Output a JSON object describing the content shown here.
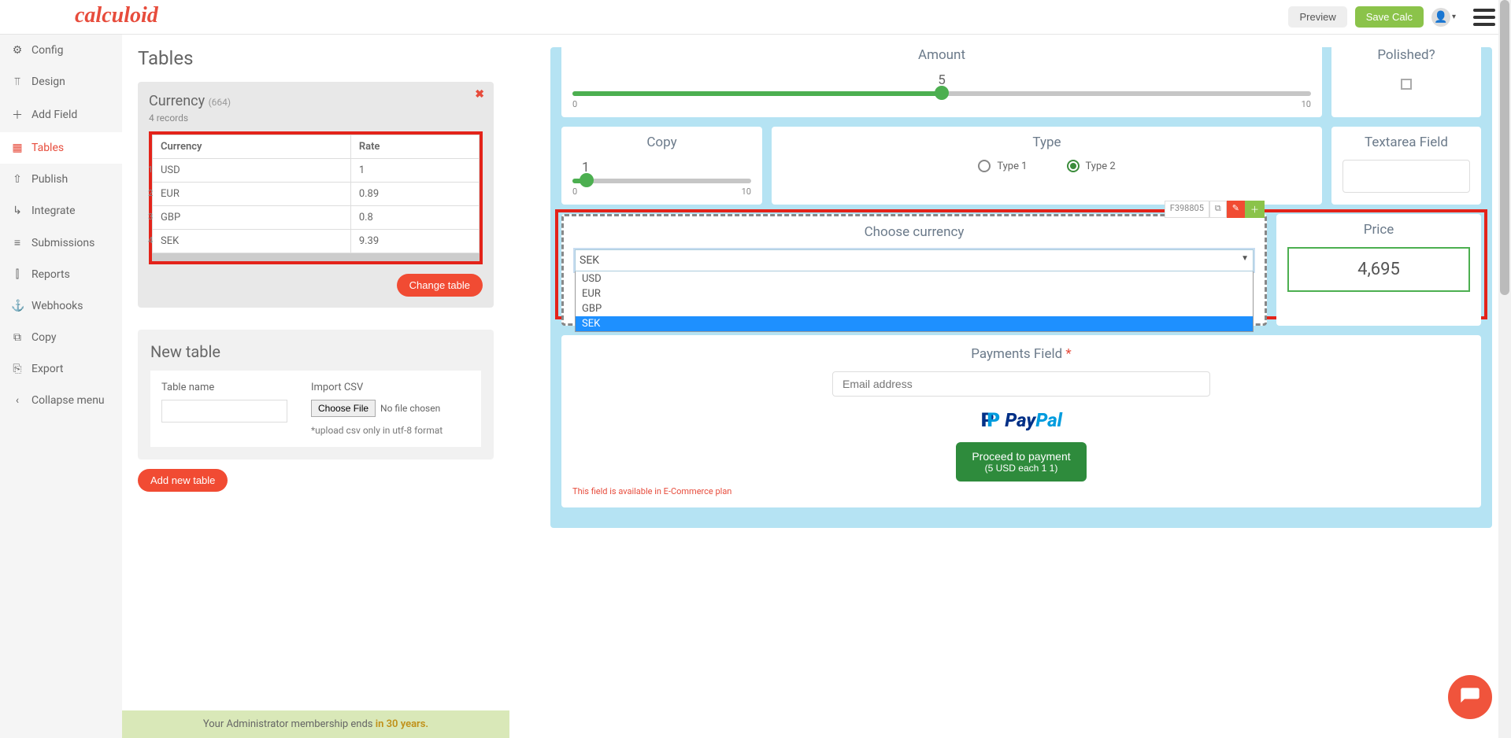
{
  "topnav": {
    "logo": "calculoid",
    "preview": "Preview",
    "save": "Save Calc"
  },
  "sidebar": {
    "items": [
      {
        "icon": "⚙",
        "label": "Config"
      },
      {
        "icon": "⊤",
        "label": "Design"
      },
      {
        "icon": "＋",
        "label": "Add Field"
      },
      {
        "icon": "▦",
        "label": "Tables"
      },
      {
        "icon": "⇧",
        "label": "Publish"
      },
      {
        "icon": "↳",
        "label": "Integrate"
      },
      {
        "icon": "≡",
        "label": "Submissions"
      },
      {
        "icon": "⫿",
        "label": "Reports"
      },
      {
        "icon": "⚓",
        "label": "Webhooks"
      },
      {
        "icon": "⧉",
        "label": "Copy"
      },
      {
        "icon": "⎘",
        "label": "Export"
      },
      {
        "icon": "‹",
        "label": "Collapse menu"
      }
    ]
  },
  "tables_panel": {
    "heading": "Tables",
    "currency": {
      "title": "Currency",
      "id": "(664)",
      "records": "4 records",
      "headers": [
        "Currency",
        "Rate"
      ],
      "rows": [
        {
          "n": "1",
          "c": "USD",
          "r": "1"
        },
        {
          "n": "2",
          "c": "EUR",
          "r": "0.89"
        },
        {
          "n": "3",
          "c": "GBP",
          "r": "0.8"
        },
        {
          "n": "4",
          "c": "SEK",
          "r": "9.39"
        }
      ],
      "change_btn": "Change table"
    },
    "new_table": {
      "title": "New table",
      "name_label": "Table name",
      "csv_label": "Import CSV",
      "choose_file": "Choose File",
      "no_file": "No file chosen",
      "hint": "*upload csv only in utf-8 format",
      "add_btn": "Add new table"
    }
  },
  "admin_bar": {
    "prefix": "Your Administrator membership ends ",
    "suffix": "in 30 years."
  },
  "calc": {
    "amount": {
      "title": "Amount",
      "value": "5",
      "min": "0",
      "max": "10"
    },
    "polished": {
      "title": "Polished?"
    },
    "copy": {
      "title": "Copy",
      "value": "1",
      "min": "0",
      "max": "10"
    },
    "type": {
      "title": "Type",
      "opt1": "Type 1",
      "opt2": "Type 2"
    },
    "textarea": {
      "title": "Textarea Field"
    },
    "currency_field": {
      "title": "Choose currency",
      "id": "F398805",
      "selected": "SEK",
      "options": [
        "USD",
        "EUR",
        "GBP",
        "SEK"
      ]
    },
    "price": {
      "title": "Price",
      "value": "4,695"
    },
    "payments": {
      "title": "Payments Field",
      "email_placeholder": "Email address",
      "brand": "PayPal",
      "proceed": "Proceed to payment",
      "detail": "(5 USD each 1 1)",
      "note": "This field is available in E-Commerce plan"
    }
  }
}
